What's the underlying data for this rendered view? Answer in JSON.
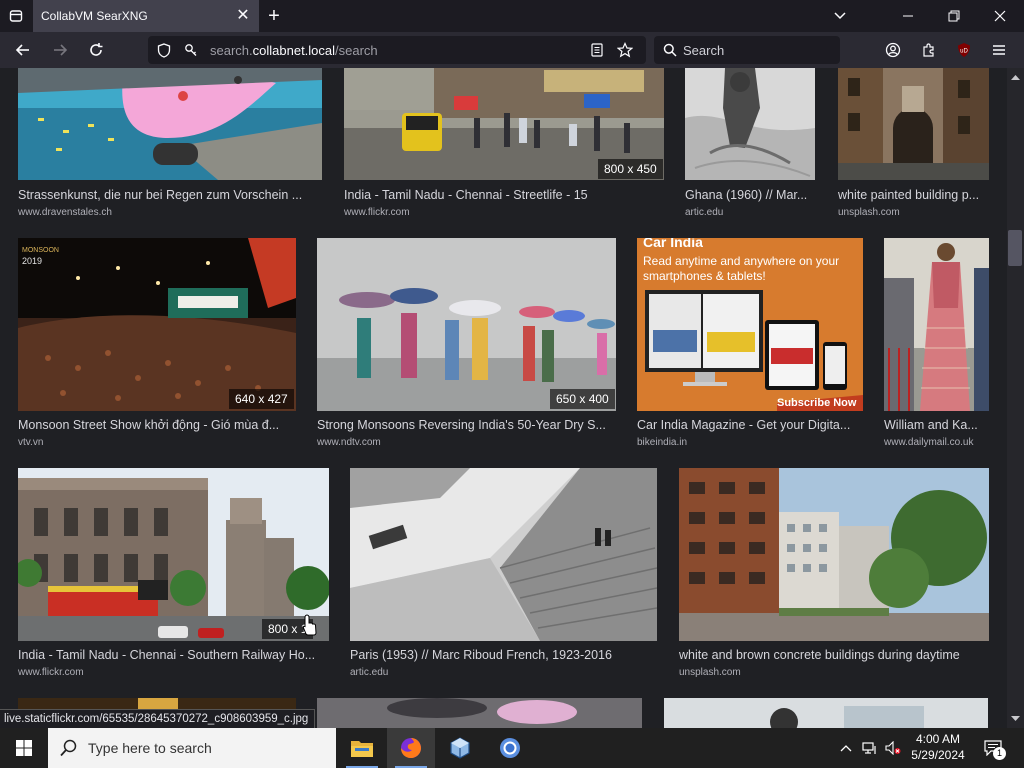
{
  "browser": {
    "tab_title": "CollabVM SearXNG",
    "url_host_prefix": "search.",
    "url_host": "collabnet.local",
    "url_path": "/search",
    "search_placeholder": "Search",
    "status_url": "live.staticflickr.com/65535/28645370272_c908603959_c.jpg",
    "accent_color": "#42414d"
  },
  "results": [
    {
      "title": "Strassenkunst, die nur bei Regen zum Vorschein ...",
      "source": "www.dravenstales.ch",
      "badge": ""
    },
    {
      "title": "India - Tamil Nadu - Chennai - Streetlife - 15",
      "source": "www.flickr.com",
      "badge": "800 x 450"
    },
    {
      "title": "Ghana (1960) // Mar...",
      "source": "artic.edu",
      "badge": ""
    },
    {
      "title": "white painted building p...",
      "source": "unsplash.com",
      "badge": ""
    },
    {
      "title": "Monsoon Street Show khởi động - Gió mùa đ...",
      "source": "vtv.vn",
      "badge": "640 x 427"
    },
    {
      "title": "Strong Monsoons Reversing India's 50-Year Dry S...",
      "source": "www.ndtv.com",
      "badge": "650 x 400"
    },
    {
      "title": "Car India Magazine - Get your Digita...",
      "source": "bikeindia.in",
      "badge": "",
      "thumb_text": {
        "brand": "Car India",
        "tagline": "Read anytime and anywhere on your smartphones & tablets!",
        "cta": "Subscribe Now"
      }
    },
    {
      "title": "William and Ka...",
      "source": "www.dailymail.co.uk",
      "badge": ""
    },
    {
      "title": "India - Tamil Nadu - Chennai - Southern Railway Ho...",
      "source": "www.flickr.com",
      "badge": "800 x 1"
    },
    {
      "title": "Paris (1953) // Marc Riboud French, 1923-2016",
      "source": "artic.edu",
      "badge": ""
    },
    {
      "title": "white and brown concrete buildings during daytime",
      "source": "unsplash.com",
      "badge": ""
    }
  ],
  "taskbar": {
    "search_placeholder": "Type here to search",
    "time": "4:00 AM",
    "date": "5/29/2024",
    "notification_count": "1",
    "apps": [
      "file-explorer",
      "firefox",
      "virtualbox",
      "chrome"
    ]
  }
}
